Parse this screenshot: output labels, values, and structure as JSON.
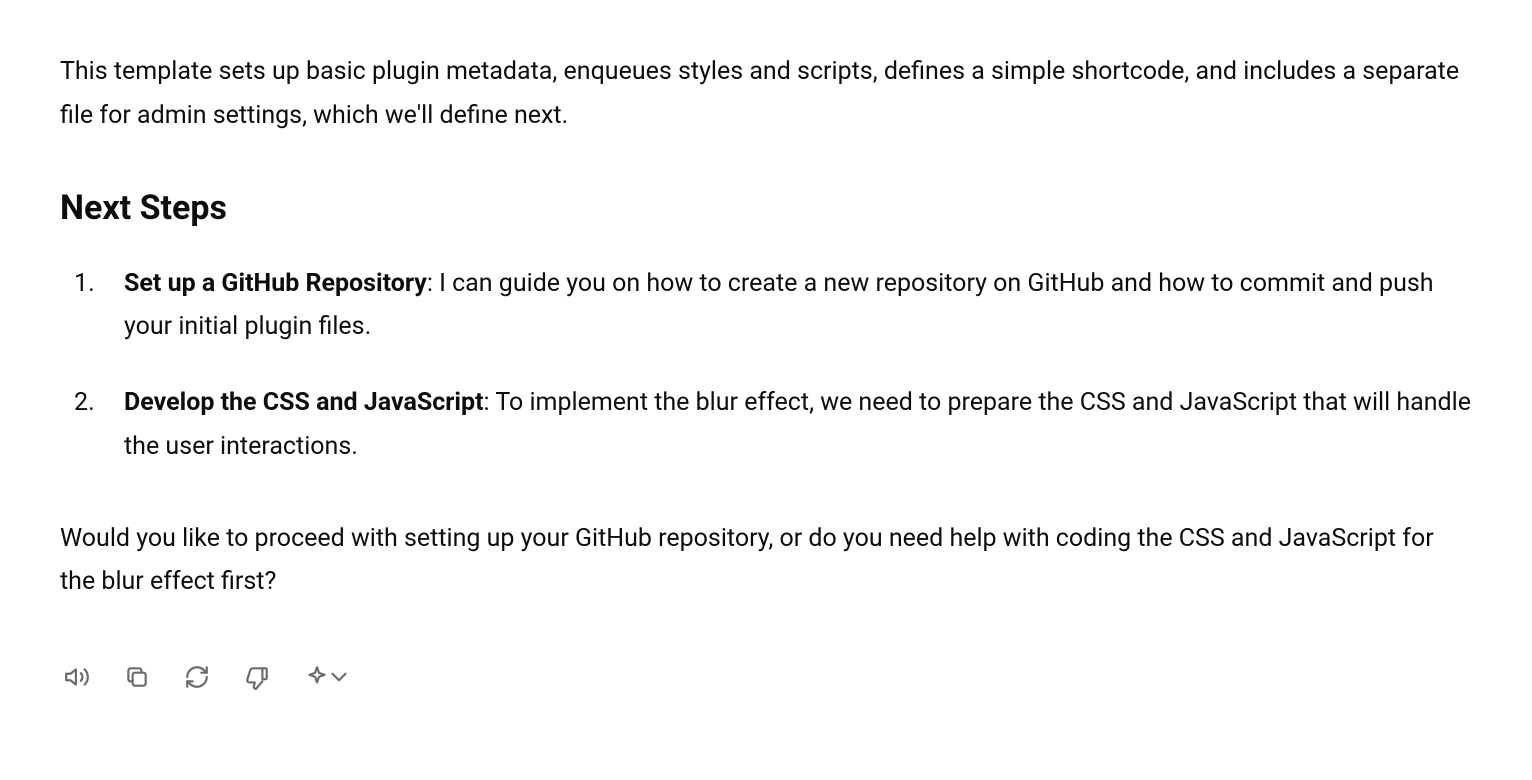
{
  "intro": "This template sets up basic plugin metadata, enqueues styles and scripts, defines a simple shortcode, and includes a separate file for admin settings, which we'll define next.",
  "heading": "Next Steps",
  "steps": [
    {
      "title": "Set up a GitHub Repository",
      "body": ": I can guide you on how to create a new repository on GitHub and how to commit and push your initial plugin files."
    },
    {
      "title": "Develop the CSS and JavaScript",
      "body": ": To implement the blur effect, we need to prepare the CSS and JavaScript that will handle the user interactions."
    }
  ],
  "closing": "Would you like to proceed with setting up your GitHub repository, or do you need help with coding the CSS and JavaScript for the blur effect first?",
  "icons": {
    "speaker": "speaker-icon",
    "copy": "copy-icon",
    "refresh": "refresh-icon",
    "thumbsdown": "thumbs-down-icon",
    "sparkle": "sparkle-icon",
    "chevron": "chevron-down-icon"
  }
}
